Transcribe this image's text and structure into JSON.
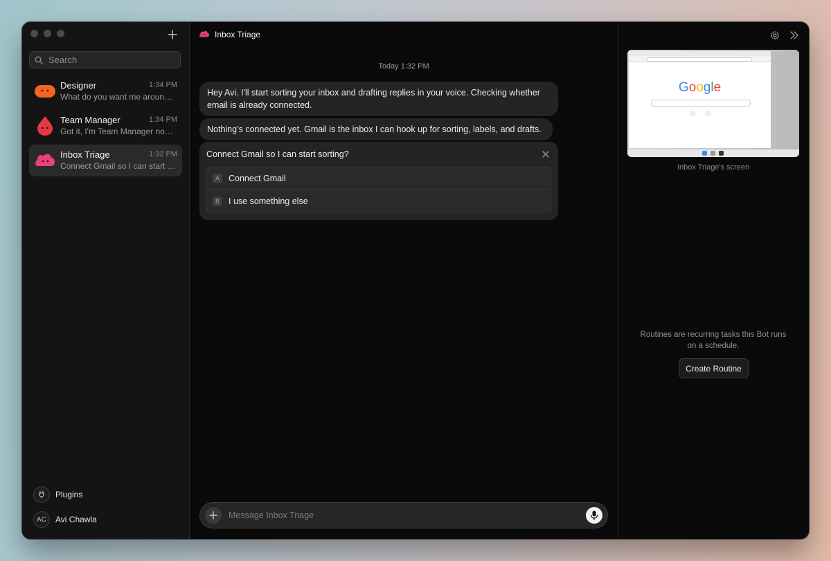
{
  "sidebar": {
    "search_placeholder": "Search",
    "chats": [
      {
        "name": "Designer",
        "time": "1:34 PM",
        "preview": "What do you want me around ..."
      },
      {
        "name": "Team Manager",
        "time": "1:34 PM",
        "preview": "Got it, I'm Team Manager now...."
      },
      {
        "name": "Inbox Triage",
        "time": "1:32 PM",
        "preview": "Connect Gmail so I can start s..."
      }
    ],
    "plugins_label": "Plugins",
    "user": {
      "initials": "AC",
      "name": "Avi Chawla"
    }
  },
  "main": {
    "title": "Inbox Triage",
    "date_separator": "Today 1:32 PM",
    "messages": [
      "Hey Avi. I'll start sorting your inbox and drafting replies in your voice. Checking whether email is already connected.",
      "Nothing’s connected yet. Gmail is the inbox I can hook up for sorting, labels, and drafts."
    ],
    "question": {
      "text": "Connect Gmail so I can start sorting?",
      "options": [
        {
          "key": "A",
          "label": "Connect Gmail"
        },
        {
          "key": "B",
          "label": "I use something else"
        }
      ]
    },
    "composer_placeholder": "Message Inbox Triage"
  },
  "right_panel": {
    "screen_caption": "Inbox Triage's screen",
    "screen_logo": "Google",
    "routines_text": "Routines are recurring tasks this Bot runs on a schedule.",
    "create_routine_label": "Create Routine"
  },
  "colors": {
    "designer_avatar": "#f26522",
    "team_manager_avatar": "#e63946",
    "inbox_triage_avatar": "#e8417a",
    "window_bg": "#0a0a0a",
    "sidebar_bg": "#141414"
  }
}
